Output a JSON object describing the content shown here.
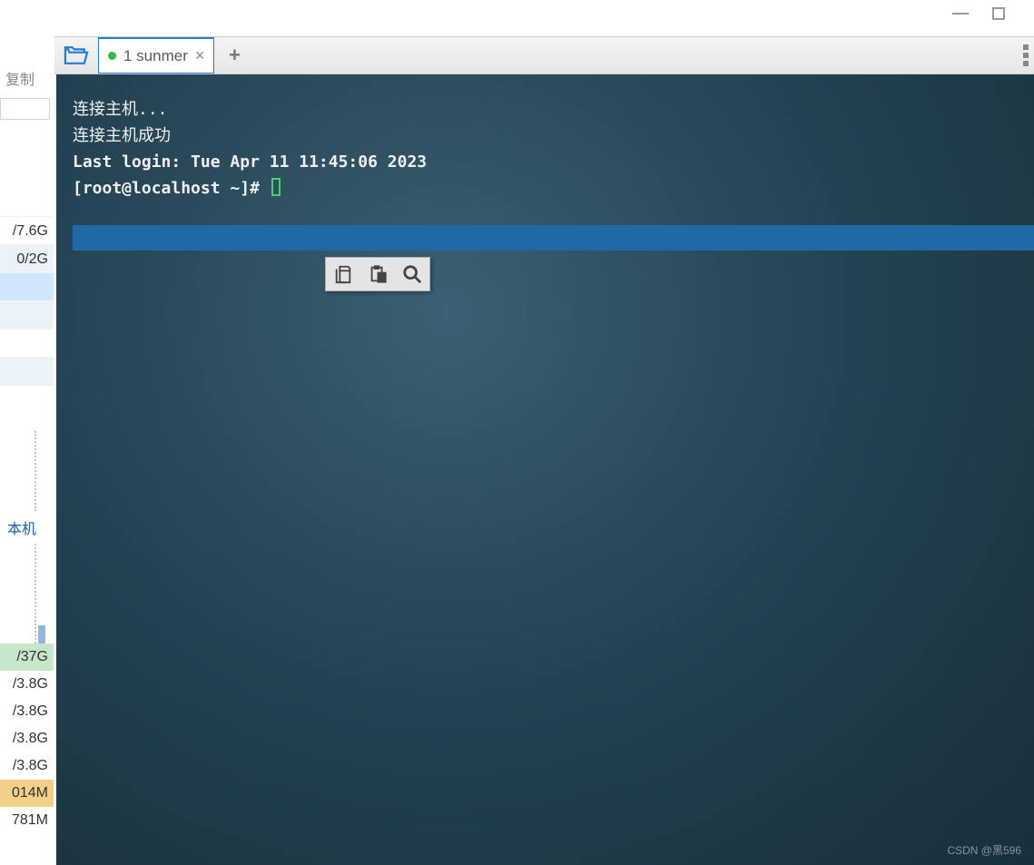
{
  "window": {
    "copy_label": "复制",
    "host_label": "本机"
  },
  "sidebar": {
    "stats_top": [
      "/7.6G",
      "0/2G"
    ],
    "stats_bottom": [
      "/37G",
      "/3.8G",
      "/3.8G",
      "/3.8G",
      "/3.8G",
      "014M",
      "781M"
    ]
  },
  "tabbar": {
    "tab_label": "1 sunmer"
  },
  "terminal": {
    "line1": "连接主机...",
    "line2": "连接主机成功",
    "line3": "Last login: Tue Apr 11 11:45:06 2023",
    "prompt": "[root@localhost ~]# "
  },
  "watermark": "CSDN @黑596"
}
